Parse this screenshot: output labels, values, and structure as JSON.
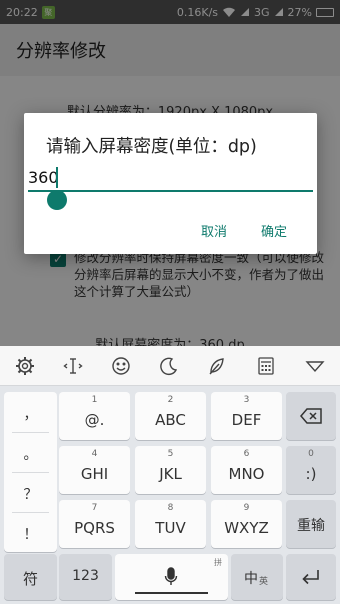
{
  "status_bar": {
    "time": "20:22",
    "notification_badge": "聚",
    "network_speed": "0.16K/s",
    "carrier": "3G",
    "battery": "27%"
  },
  "app_bar": {
    "title": "分辨率修改"
  },
  "content": {
    "default_resolution": "默认分辨率为：1920px X 1080px",
    "checkbox_label": "修改分辨率时保持屏幕密度一致（可以使修改分辨率后屏幕的显示大小不变，作者为了做出这个计算了大量公式）",
    "checkbox_checked": true,
    "default_density": "默认屏幕密度为：360 dp"
  },
  "dialog": {
    "title": "请输入屏幕密度(单位：dp)",
    "input_value": "360",
    "cancel_label": "取消",
    "confirm_label": "确定",
    "accent_color": "#0e7a6c"
  },
  "keyboard": {
    "toolbar_icons": [
      "gear-icon",
      "cursor-icon",
      "smiley-icon",
      "moon-icon",
      "feather-icon",
      "calculator-icon",
      "collapse-icon"
    ],
    "side_keys": [
      "，",
      "。",
      "？",
      "！"
    ],
    "rows": [
      [
        {
          "sub": "1",
          "main": "@."
        },
        {
          "sub": "2",
          "main": "ABC"
        },
        {
          "sub": "3",
          "main": "DEF"
        }
      ],
      [
        {
          "sub": "4",
          "main": "GHI"
        },
        {
          "sub": "5",
          "main": "JKL"
        },
        {
          "sub": "6",
          "main": "MNO"
        }
      ],
      [
        {
          "sub": "7",
          "main": "PQRS"
        },
        {
          "sub": "8",
          "main": "TUV"
        },
        {
          "sub": "9",
          "main": "WXYZ"
        }
      ]
    ],
    "zero_key": {
      "sub": "0",
      "main": ":)"
    },
    "reenter_label": "重输",
    "symbol_label": "符",
    "numeric_label": "123",
    "space_hint": "拼",
    "lang_main": "中",
    "lang_sub": "英"
  }
}
